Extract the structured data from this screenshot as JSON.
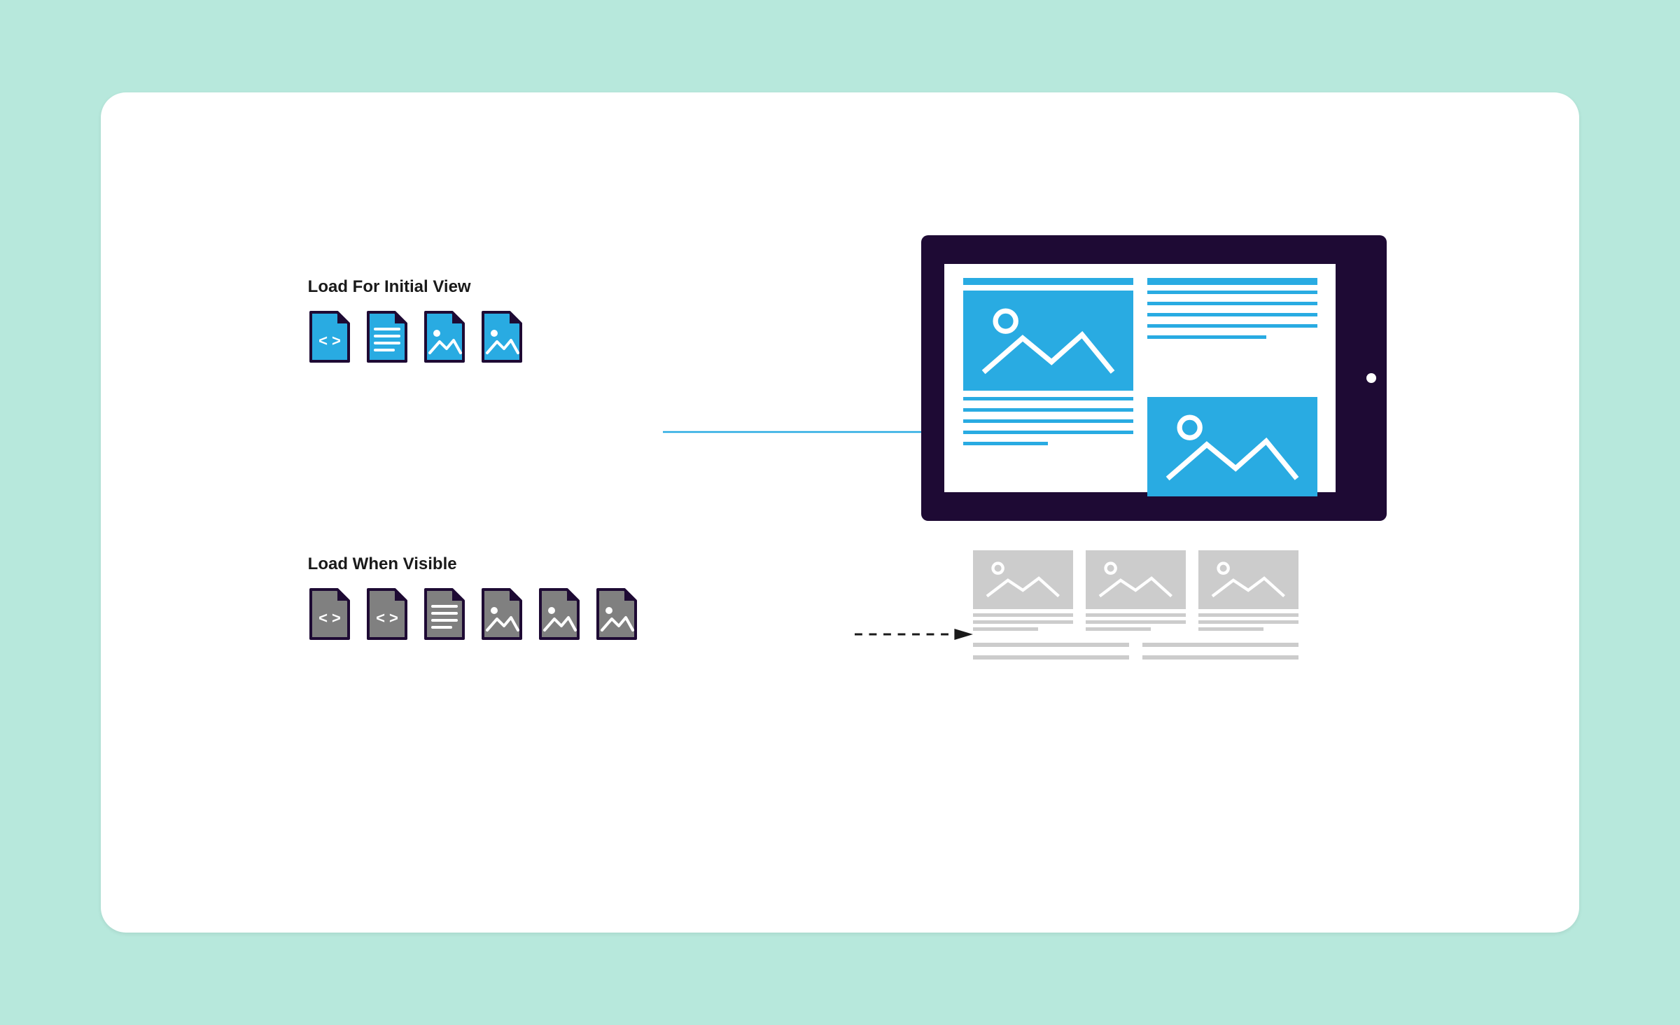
{
  "labels": {
    "initial": "Load For Initial View",
    "deferred": "Load When Visible"
  },
  "groups": {
    "initial": {
      "files": [
        {
          "kind": "code"
        },
        {
          "kind": "text"
        },
        {
          "kind": "image"
        },
        {
          "kind": "image"
        }
      ],
      "color_fill": "#29abe2",
      "color_stroke": "#1e0a34"
    },
    "deferred": {
      "files": [
        {
          "kind": "code"
        },
        {
          "kind": "code"
        },
        {
          "kind": "text"
        },
        {
          "kind": "image"
        },
        {
          "kind": "image"
        },
        {
          "kind": "image"
        }
      ],
      "color_fill": "#808080",
      "color_stroke": "#1e0a34"
    }
  },
  "colors": {
    "page_bg": "#b7e8dc",
    "card_bg": "#ffffff",
    "accent": "#29abe2",
    "muted": "#cccccc",
    "device": "#1e0a34",
    "text": "#1a1a1a"
  },
  "icons": {
    "code": "code-file-icon",
    "text": "text-file-icon",
    "image": "image-file-icon",
    "arrow_solid": "arrow-right-solid-icon",
    "arrow_dashed": "arrow-right-dashed-icon",
    "tablet": "tablet-device-icon",
    "placeholder_image": "image-placeholder-icon"
  }
}
